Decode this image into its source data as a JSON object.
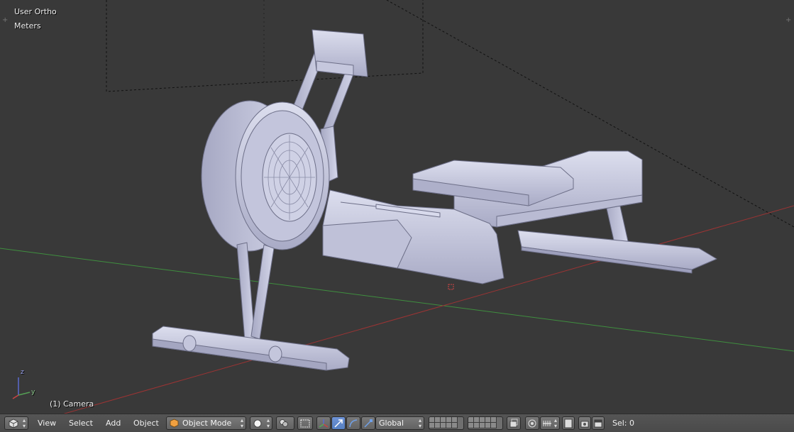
{
  "viewport": {
    "view_name": "User Ortho",
    "units": "Meters",
    "object_label": "(1) Camera",
    "axis_z": "z",
    "axis_y": "y"
  },
  "header": {
    "menus": [
      "View",
      "Select",
      "Add",
      "Object"
    ],
    "mode": "Object Mode",
    "orientation": "Global",
    "selection_info": "Sel: 0"
  },
  "colors": {
    "background": "#393939",
    "x_axis": "#9b3434",
    "y_axis": "#3f8f3f",
    "model": "#c7c9de",
    "accent": "#5680c2"
  },
  "icons": {
    "editor_type": "cube-icon",
    "shading": "sphere-icon",
    "pivot": "pivot-icon",
    "manipulator": "manipulator-icon",
    "snap": "magnet-icon",
    "render": "camera-icon"
  }
}
